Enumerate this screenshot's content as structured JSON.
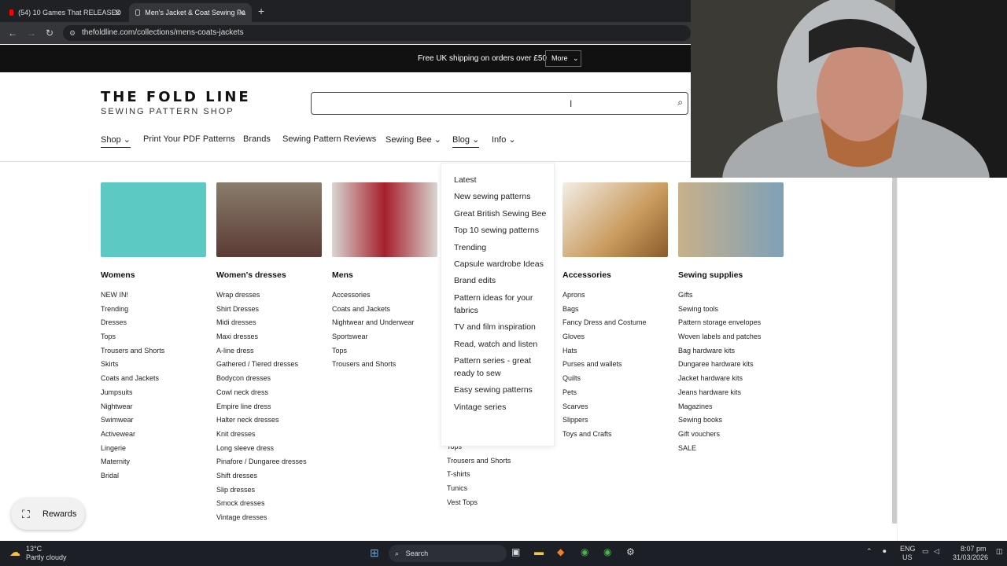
{
  "browser": {
    "tabs": [
      {
        "title": "(54) 10 Games That RELEASED"
      },
      {
        "title": "Men's Jacket & Coat Sewing Pa"
      }
    ],
    "url": "thefoldline.com/collections/mens-coats-jackets"
  },
  "promo": {
    "text": "Free UK shipping on orders over £50",
    "more": "More"
  },
  "logo": {
    "line1": "THE FOLD LINE",
    "line2": "SEWING PATTERN SHOP"
  },
  "nav": [
    {
      "label": "Shop"
    },
    {
      "label": "Print Your PDF Patterns"
    },
    {
      "label": "Brands"
    },
    {
      "label": "Sewing Pattern Reviews"
    },
    {
      "label": "Sewing Bee"
    },
    {
      "label": "Blog"
    },
    {
      "label": "Info"
    }
  ],
  "columns": [
    {
      "title": "Womens",
      "items": [
        "NEW IN!",
        "Trending",
        "Dresses",
        "Tops",
        "Trousers and Shorts",
        "Skirts",
        "Coats and Jackets",
        "Jumpsuits",
        "Nightwear",
        "Swimwear",
        "Activewear",
        "Lingerie",
        "Maternity",
        "Bridal"
      ]
    },
    {
      "title": "Women's dresses",
      "items": [
        "Wrap dresses",
        "Shirt Dresses",
        "Midi dresses",
        "Maxi dresses",
        "A-line dress",
        "Gathered / Tiered dresses",
        "Bodycon dresses",
        "Cowl neck dress",
        "Empire line dress",
        "Halter neck dresses",
        "Knit dresses",
        "Long sleeve dress",
        "Pinafore / Dungaree dresses",
        "Shift dresses",
        "Slip dresses",
        "Smock dresses",
        "Vintage dresses"
      ]
    },
    {
      "title": "Mens",
      "items": [
        "Accessories",
        "Coats and Jackets",
        "Nightwear and Underwear",
        "Sportswear",
        "Tops",
        "Trousers and Shorts"
      ]
    },
    {
      "title": "",
      "items": [
        "Tops",
        "Trousers and Shorts",
        "T-shirts",
        "Tunics",
        "Vest Tops"
      ]
    },
    {
      "title": "Accessories",
      "items": [
        "Aprons",
        "Bags",
        "Fancy Dress and Costume",
        "Gloves",
        "Hats",
        "Purses and wallets",
        "Quilts",
        "Pets",
        "Scarves",
        "Slippers",
        "Toys and Crafts"
      ]
    },
    {
      "title": "Sewing supplies",
      "items": [
        "Gifts",
        "Sewing tools",
        "Pattern storage envelopes",
        "Woven labels and patches",
        "Bag hardware kits",
        "Dungaree hardware kits",
        "Jacket hardware kits",
        "Jeans hardware kits",
        "Magazines",
        "Sewing books",
        "Gift vouchers",
        "SALE"
      ]
    }
  ],
  "blog_dropdown": [
    "Latest",
    "New sewing patterns",
    "Great British Sewing Bee",
    "Top 10 sewing patterns",
    "Trending",
    "Capsule wardrobe Ideas",
    "Brand edits",
    "Pattern ideas for your fabrics",
    "TV and film inspiration",
    "Read, watch and listen",
    "Pattern series - great ready to sew",
    "Easy sewing patterns",
    "Vintage series"
  ],
  "rewards": "Rewards",
  "taskbar": {
    "weather_temp": "13°C",
    "weather_desc": "Partly cloudy",
    "search": "Search",
    "lang1": "ENG",
    "lang2": "US",
    "time": "8:07 pm",
    "date": "31/03/2026"
  },
  "colors": {
    "promo_bg": "#111111",
    "taskbar_bg": "#1c1f26",
    "womens_img": "#5cc9c2",
    "accent": "#111111"
  }
}
